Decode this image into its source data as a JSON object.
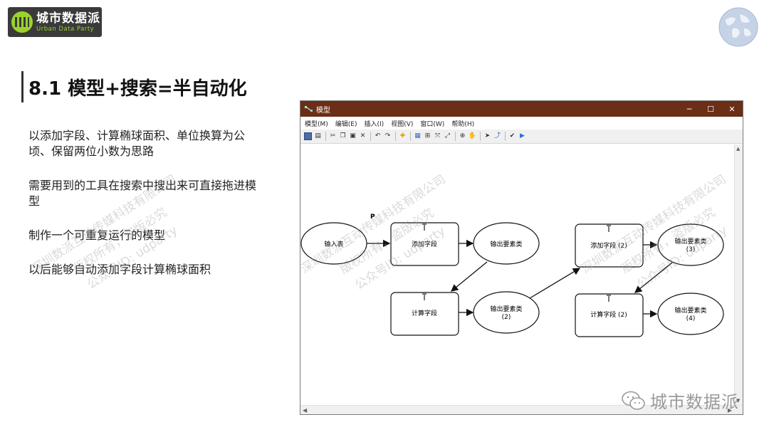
{
  "logo": {
    "cn": "城市数据派",
    "en": "Urban Data Party"
  },
  "page": {
    "title": "8.1 模型+搜索=半自动化",
    "bullets": [
      "以添加字段、计算椭球面积、单位换算为公顷、保留两位小数为思路",
      "需要用到的工具在搜索中搜出来可直接拖进模型",
      "制作一个可重复运行的模型",
      "以后能够自动添加字段计算椭球面积"
    ]
  },
  "watermarks": {
    "company": "深圳数派互动传媒科技有限公司",
    "rights": "版权所有，盗版必究",
    "account": "公众号ID: udparty"
  },
  "window": {
    "title": "模型",
    "controls": {
      "minimize": "─",
      "maximize": "☐",
      "close": "✕"
    },
    "menu": [
      "模型(M)",
      "编辑(E)",
      "插入(I)",
      "视图(V)",
      "窗口(W)",
      "帮助(H)"
    ]
  },
  "model": {
    "cursor_label": "P",
    "nodes": {
      "input": "输入表",
      "add_field_1": "添加字段",
      "output_1": "输出要素类",
      "calc_field_1": "计算字段",
      "output_2": "输出要素类",
      "output_2_num": "(2)",
      "add_field_2": "添加字段 (2)",
      "output_3": "输出要素类",
      "output_3_num": "(3)",
      "calc_field_2": "计算字段 (2)",
      "output_4": "输出要素类",
      "output_4_num": "(4)"
    }
  },
  "footer": {
    "brand": "城市数据派"
  },
  "colors": {
    "titlebar": "#6b2e16",
    "logo_green": "#9bd22d"
  }
}
